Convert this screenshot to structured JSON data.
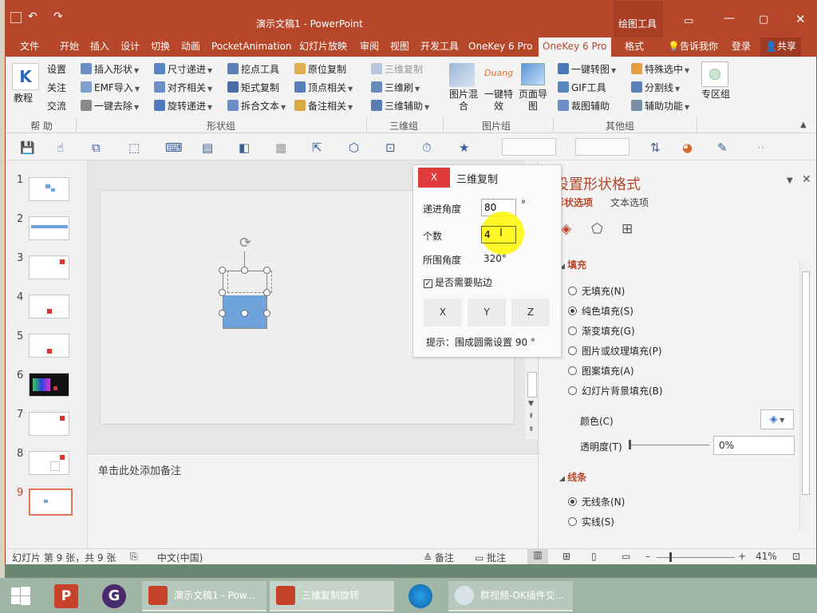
{
  "window": {
    "title": "演示文稿1 - PowerPoint",
    "context_tab_group": "绘图工具",
    "tell_me": "告诉我你",
    "login": "登录",
    "share": "共享"
  },
  "tabs": [
    "文件",
    "开始",
    "插入",
    "设计",
    "切换",
    "动画",
    "PocketAnimation",
    "幻灯片放映",
    "审阅",
    "视图",
    "开发工具",
    "OneKey 6 Pro",
    "OneKey 6 Pro",
    "格式"
  ],
  "ribbon": {
    "group_help": {
      "label": "帮 助",
      "tutorial": "教程",
      "settings": "设置",
      "follow": "关注",
      "exchange": "交流"
    },
    "group_shape": {
      "label": "形状组",
      "insert_shape": "插入形状",
      "emf_import": "EMF导入",
      "one_key_remove": "一键去除",
      "size_step": "尺寸递进",
      "align_related": "对齐相关",
      "rotate_step": "旋转递进",
      "pick_tool": "挖点工具",
      "matrix_copy": "矩式复制",
      "split_text": "拆合文本",
      "original_copy": "原位复制",
      "vertex_related": "顶点相关",
      "note_related": "备注相关"
    },
    "group_3d": {
      "label": "三维组",
      "copy_3d": "三维复制",
      "brush_3d": "三维刷",
      "assist_3d": "三维辅助"
    },
    "group_image": {
      "label": "图片组",
      "image_mix": "图片混合",
      "one_key_effect": "一键特效",
      "page_export": "页面导图",
      "duang": "Duang"
    },
    "group_other": {
      "label": "其他组",
      "one_key_image": "一键转图",
      "gif_tool": "GIF工具",
      "crop_assist": "裁图辅助",
      "special_select": "特殊选中",
      "divider": "分割线",
      "assist_func": "辅助功能",
      "zone": "专区组"
    }
  },
  "slides": [
    {
      "num": "1"
    },
    {
      "num": "2"
    },
    {
      "num": "3"
    },
    {
      "num": "4"
    },
    {
      "num": "5"
    },
    {
      "num": "6"
    },
    {
      "num": "7"
    },
    {
      "num": "8"
    },
    {
      "num": "9"
    }
  ],
  "notes_placeholder": "单击此处添加备注",
  "dialog": {
    "close": "X",
    "title": "三维复制",
    "step_angle_label": "递进角度",
    "step_angle_value": "80",
    "degree": "°",
    "count_label": "个数",
    "count_value": "4",
    "total_angle_label": "所围角度",
    "total_angle_value": "320°",
    "snap_label": "是否需要贴边",
    "axis": [
      "X",
      "Y",
      "Z"
    ],
    "hint": "提示：围成圆需设置 90 °"
  },
  "format_pane": {
    "title": "设置形状格式",
    "tab_shape": "形状选项",
    "tab_text": "文本选项",
    "fill_header": "填充",
    "fill_options": [
      "无填充(N)",
      "纯色填充(S)",
      "渐变填充(G)",
      "图片或纹理填充(P)",
      "图案填充(A)",
      "幻灯片背景填充(B)"
    ],
    "fill_selected_index": 1,
    "color_label": "颜色(C)",
    "transparency_label": "透明度(T)",
    "transparency_value": "0%",
    "line_header": "线条",
    "line_options": [
      "无线条(N)",
      "实线(S)"
    ]
  },
  "status": {
    "slide_info": "幻灯片 第 9 张，共 9 张",
    "language": "中文(中国)",
    "notes": "备注",
    "comments": "批注",
    "zoom": "41%"
  },
  "taskbar": {
    "items": [
      "演示文稿1 - Pow...",
      "三维复制旋转",
      "群视频-OK插件交..."
    ]
  },
  "colors": {
    "accent": "#b7472a",
    "shape_fill": "#6fa3dc",
    "dialog_close": "#e03b3b"
  }
}
